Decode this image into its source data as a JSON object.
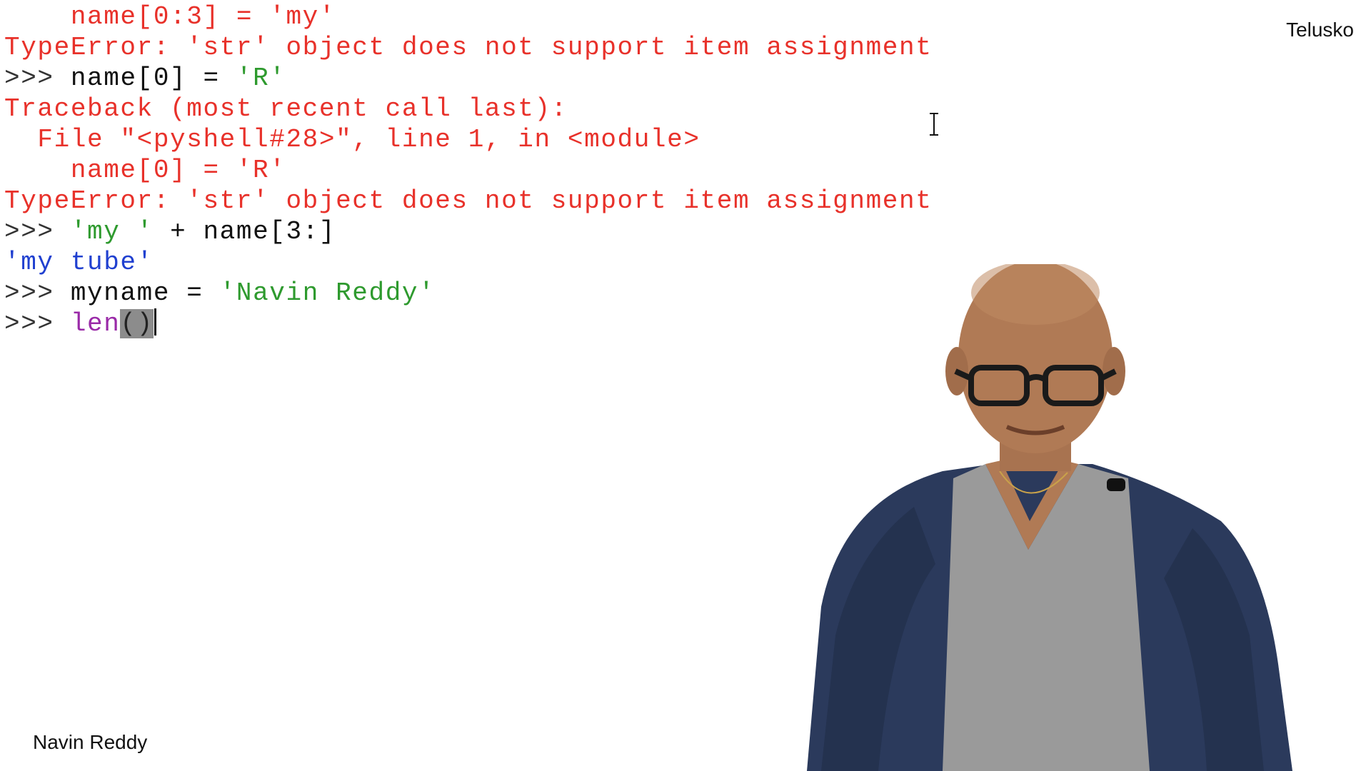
{
  "shell": {
    "lines": [
      [
        {
          "cls": "err",
          "text": "    name[0:3] = 'my'"
        }
      ],
      [
        {
          "cls": "err",
          "text": "TypeError: 'str' object does not support item assignment"
        }
      ],
      [
        {
          "cls": "prompt",
          "text": ">>> "
        },
        {
          "cls": "code",
          "text": "name[0] = "
        },
        {
          "cls": "str",
          "text": "'R'"
        }
      ],
      [
        {
          "cls": "err",
          "text": "Traceback (most recent call last):"
        }
      ],
      [
        {
          "cls": "err",
          "text": "  File \"<pyshell#28>\", line 1, in <module>"
        }
      ],
      [
        {
          "cls": "err",
          "text": "    name[0] = 'R'"
        }
      ],
      [
        {
          "cls": "err",
          "text": "TypeError: 'str' object does not support item assignment"
        }
      ],
      [
        {
          "cls": "prompt",
          "text": ">>> "
        },
        {
          "cls": "str",
          "text": "'my '"
        },
        {
          "cls": "code",
          "text": " + name[3:]"
        }
      ],
      [
        {
          "cls": "out",
          "text": "'my tube'"
        }
      ],
      [
        {
          "cls": "prompt",
          "text": ">>> "
        },
        {
          "cls": "code",
          "text": "myname = "
        },
        {
          "cls": "str",
          "text": "'Navin Reddy'"
        }
      ]
    ],
    "current_input": {
      "prompt": ">>> ",
      "builtin": "len",
      "parens": "()"
    }
  },
  "overlay": {
    "channel": "Telusko",
    "presenter": "Navin Reddy"
  },
  "icons": {
    "cursor": "text-cursor-icon"
  },
  "colors": {
    "error": "#e8312a",
    "string": "#2e9a2e",
    "output": "#2040d0",
    "builtin": "#9a2aa8",
    "jacket": "#2b3a5c",
    "shirt": "#9a9a9a",
    "skin": "#b07a55"
  }
}
